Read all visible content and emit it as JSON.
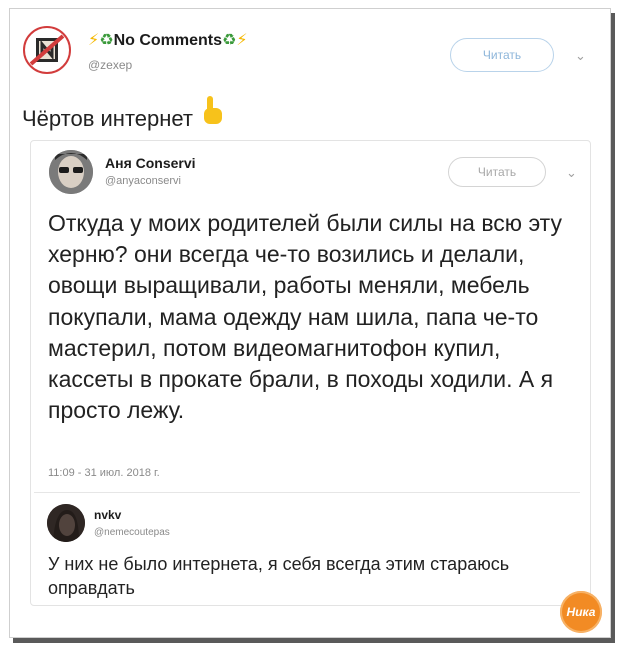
{
  "main_tweet": {
    "display_name": "No Comments",
    "handle": "@zexep",
    "follow_label": "Читать",
    "text": "Чёртов интернет"
  },
  "quoted": {
    "display_name": "Аня Conservi",
    "handle": "@anyaconservi",
    "follow_label": "Читать",
    "text": "Откуда у моих родителей были силы на всю эту херню? они всегда че-то возились и делали, овощи выращивали,  работы меняли, мебель покупали, мама одежду нам шила, папа че-то мастерил, потом видеомагнитофон купил, кассеты в прокате брали, в походы ходили. А я просто лежу.",
    "timestamp": "11:09 - 31 июл. 2018 г."
  },
  "reply": {
    "display_name": "nvkv",
    "handle": "@nemecoutepas",
    "text": "У них не было интернета, я себя всегда этим стараюсь оправдать"
  },
  "watermark": {
    "text": "Ника"
  },
  "colors": {
    "follow_border": "#b9d3ea",
    "accent_bolt": "#f5b800",
    "recycle_green": "#3b9a3b",
    "logo_orange": "#f28b24"
  }
}
